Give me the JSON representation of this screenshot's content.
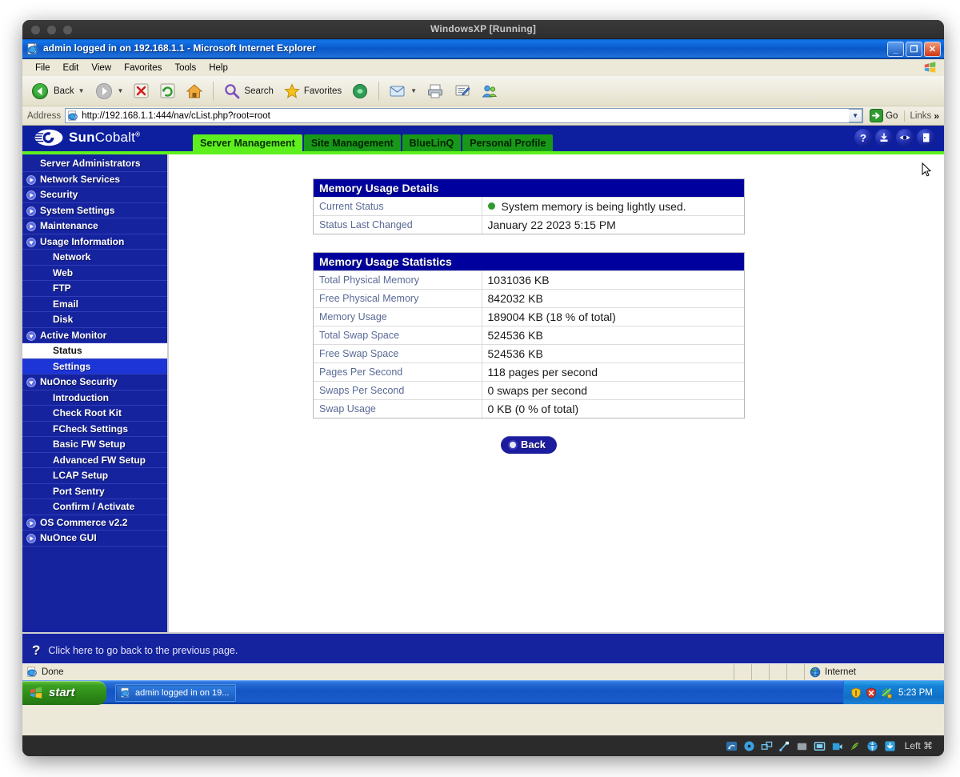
{
  "vbox": {
    "title": "WindowsXP [Running]",
    "hostkey": "Left ⌘",
    "status_icons": [
      "hard-disk-icon",
      "optical-disk-icon",
      "network-icon",
      "usb-icon",
      "shared-folder-icon",
      "display-icon",
      "video-capture-icon",
      "mouse-integration-icon",
      "globe-icon",
      "host-key-icon"
    ]
  },
  "browser": {
    "title": "admin logged in on 192.168.1.1 - Microsoft Internet Explorer",
    "window_buttons": {
      "minimize": "_",
      "maximize": "❐",
      "close": "✕"
    },
    "menu": [
      "File",
      "Edit",
      "View",
      "Favorites",
      "Tools",
      "Help"
    ],
    "toolbar": {
      "back": "Back",
      "forward": "",
      "stop": "",
      "refresh": "",
      "home": "",
      "search": "Search",
      "favorites": "Favorites",
      "media": "",
      "mail": "",
      "print": "",
      "edit": "",
      "messenger": ""
    },
    "address": {
      "label": "Address",
      "url": "http://192.168.1.1:444/nav/cList.php?root=root",
      "go": "Go",
      "links": "Links",
      "links_chevron": "»"
    },
    "status": {
      "text": "Done",
      "zone": "Internet"
    }
  },
  "taskbar": {
    "start": "start",
    "items": [
      {
        "label": "admin logged in on 19..."
      }
    ],
    "tray": {
      "time": "5:23 PM",
      "icons": [
        "security-shield-icon",
        "antivirus-icon",
        "network-activity-icon"
      ]
    }
  },
  "cobalt": {
    "brand": {
      "sun": "Sun",
      "cobalt": "Cobalt",
      "tm": "®"
    },
    "tabs": [
      {
        "label": "Server Management",
        "active": true
      },
      {
        "label": "Site Management",
        "active": false
      },
      {
        "label": "BlueLinQ",
        "active": false
      },
      {
        "label": "Personal Profile",
        "active": false
      }
    ],
    "header_icons": [
      {
        "name": "help-icon",
        "glyph": "?"
      },
      {
        "name": "save-icon",
        "glyph": "⇩"
      },
      {
        "name": "preview-eye-icon",
        "glyph": "◉"
      },
      {
        "name": "logout-door-icon",
        "glyph": "▯"
      }
    ],
    "nav": [
      {
        "label": "Server Administrators",
        "level": 1,
        "state": "none"
      },
      {
        "label": "Network Services",
        "level": 1,
        "state": "collapsed"
      },
      {
        "label": "Security",
        "level": 1,
        "state": "collapsed"
      },
      {
        "label": "System Settings",
        "level": 1,
        "state": "collapsed"
      },
      {
        "label": "Maintenance",
        "level": 1,
        "state": "collapsed"
      },
      {
        "label": "Usage Information",
        "level": 1,
        "state": "expanded"
      },
      {
        "label": "Network",
        "level": 2,
        "state": "none"
      },
      {
        "label": "Web",
        "level": 2,
        "state": "none"
      },
      {
        "label": "FTP",
        "level": 2,
        "state": "none"
      },
      {
        "label": "Email",
        "level": 2,
        "state": "none"
      },
      {
        "label": "Disk",
        "level": 2,
        "state": "none"
      },
      {
        "label": "Active Monitor",
        "level": 1,
        "state": "expanded"
      },
      {
        "label": "Status",
        "level": 2,
        "state": "none",
        "selected": true
      },
      {
        "label": "Settings",
        "level": 2,
        "state": "none",
        "highlight": true
      },
      {
        "label": "NuOnce Security",
        "level": 1,
        "state": "expanded"
      },
      {
        "label": "Introduction",
        "level": 2,
        "state": "none"
      },
      {
        "label": "Check Root Kit",
        "level": 2,
        "state": "none"
      },
      {
        "label": "FCheck Settings",
        "level": 2,
        "state": "none"
      },
      {
        "label": "Basic FW Setup",
        "level": 2,
        "state": "none"
      },
      {
        "label": "Advanced FW Setup",
        "level": 2,
        "state": "none"
      },
      {
        "label": "LCAP Setup",
        "level": 2,
        "state": "none"
      },
      {
        "label": "Port Sentry",
        "level": 2,
        "state": "none"
      },
      {
        "label": "Confirm / Activate",
        "level": 2,
        "state": "none"
      },
      {
        "label": "OS Commerce v2.2",
        "level": 1,
        "state": "collapsed"
      },
      {
        "label": "NuOnce GUI",
        "level": 1,
        "state": "collapsed"
      }
    ],
    "details_panel": {
      "title": "Memory Usage Details",
      "rows": [
        {
          "label": "Current Status",
          "value": "System memory is being lightly used.",
          "dot": "#2d9b2d"
        },
        {
          "label": "Status Last Changed",
          "value": "January 22 2023 5:15 PM"
        }
      ]
    },
    "stats_panel": {
      "title": "Memory Usage Statistics",
      "rows": [
        {
          "label": "Total Physical Memory",
          "value": "1031036 KB"
        },
        {
          "label": "Free Physical Memory",
          "value": "842032 KB"
        },
        {
          "label": "Memory Usage",
          "value": "189004 KB (18 % of total)"
        },
        {
          "label": "Total Swap Space",
          "value": "524536 KB"
        },
        {
          "label": "Free Swap Space",
          "value": "524536 KB"
        },
        {
          "label": "Pages Per Second",
          "value": "118 pages per second"
        },
        {
          "label": "Swaps Per Second",
          "value": "0 swaps per second"
        },
        {
          "label": "Swap Usage",
          "value": "0 KB (0 % of total)"
        }
      ]
    },
    "back_button": {
      "label": "Back"
    },
    "footer": {
      "icon": "?",
      "text": "Click here to go back to the previous page."
    }
  }
}
